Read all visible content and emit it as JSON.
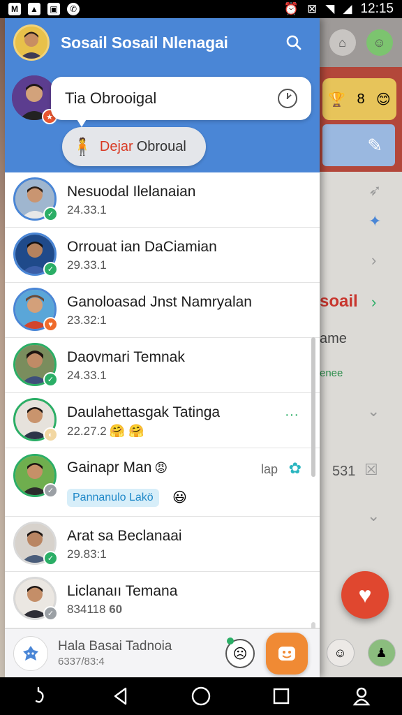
{
  "status_bar": {
    "time": "12:15",
    "left_icons": [
      "notification-m-icon",
      "image-icon",
      "photo-icon",
      "whatsapp-icon"
    ],
    "right_icons": [
      "alarm-icon",
      "vibrate-icon",
      "wifi-icon",
      "signal-icon",
      "battery-icon"
    ]
  },
  "header": {
    "title": "Sosail Sosail Nlenagai",
    "search_icon": "search-icon"
  },
  "banner": {
    "bubble_text": "Tia Obrooigal",
    "chip_red": "Dejar",
    "chip_dark": "Obroual"
  },
  "contacts": [
    {
      "name": "Nesuodal Ilelanaian",
      "time": "24.33.1",
      "badge": "green"
    },
    {
      "name": "Orrouat ian DaCiamian",
      "time": "29.33.1",
      "badge": "green"
    },
    {
      "name": "Ganoloasad Jnst Namryalan",
      "time": "23.32:1",
      "badge": "orange"
    },
    {
      "name": "Daovmari Temnak",
      "time": "24.33.1",
      "badge": "green"
    },
    {
      "name": "Daulahettasgak Tatinga",
      "time": "22.27.2",
      "badge": "beige",
      "emojis": "🤗 🤗"
    },
    {
      "name": "Gainapr Man",
      "name_emoji": "😡",
      "tag": "Pannanulo Lakö",
      "tag_emoji": "😃",
      "right_text": "lap",
      "badge": "grey"
    },
    {
      "name": "Arat sa Beclanaai",
      "time": "29.83:1",
      "badge": "green"
    },
    {
      "name": "Liclanaıı Temana",
      "time": "834118",
      "time_extra": "60",
      "badge": "grey"
    }
  ],
  "composer": {
    "line1": "Hala Basai Tadnoia",
    "line2": "6337/83:4"
  },
  "background": {
    "red_text": "soail",
    "dark_text": "ame",
    "green_text": "enee",
    "number_text": "531",
    "card_number": "8"
  },
  "colors": {
    "header_blue": "#4a86d6",
    "accent_orange": "#f08a34",
    "badge_green": "#2bae66",
    "fab_red": "#e0472f"
  }
}
